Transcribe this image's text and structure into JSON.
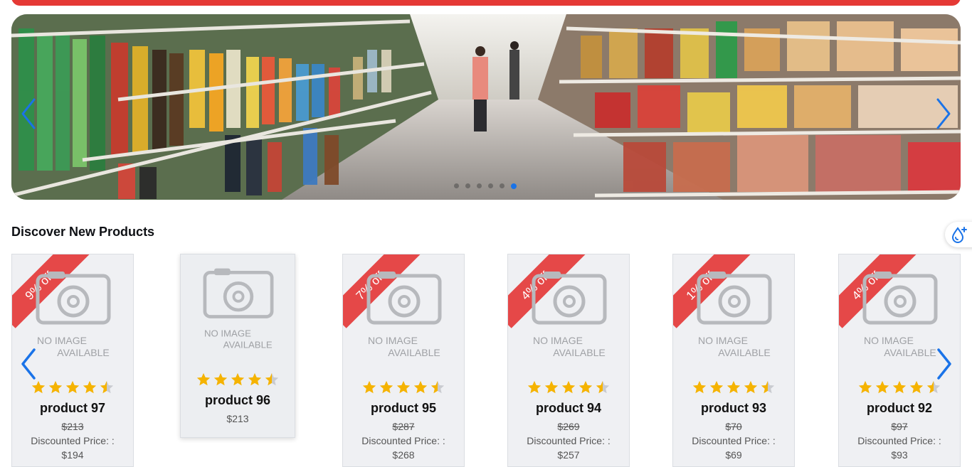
{
  "banner": {
    "slide_count": 6,
    "active_slide": 6
  },
  "section": {
    "title": "Discover New Products"
  },
  "products": [
    {
      "name": "product 97",
      "discount_badge": "9% off",
      "original_price": "$213",
      "discount_label": "Discounted Price: :",
      "discounted_price": "$194",
      "rating": 4.5
    },
    {
      "name": "product 96",
      "discount_badge": "",
      "price": "$213",
      "rating": 4.5
    },
    {
      "name": "product 95",
      "discount_badge": "7% off",
      "original_price": "$287",
      "discount_label": "Discounted Price: :",
      "discounted_price": "$268",
      "rating": 4.5
    },
    {
      "name": "product 94",
      "discount_badge": "4% off",
      "original_price": "$269",
      "discount_label": "Discounted Price: :",
      "discounted_price": "$257",
      "rating": 4.5
    },
    {
      "name": "product 93",
      "discount_badge": "1% off",
      "original_price": "$70",
      "discount_label": "Discounted Price: :",
      "discounted_price": "$69",
      "rating": 4.5
    },
    {
      "name": "product 92",
      "discount_badge": "4% off",
      "original_price": "$97",
      "discount_label": "Discounted Price: :",
      "discounted_price": "$93",
      "rating": 4.5
    }
  ],
  "placeholder_image": {
    "line1": "NO IMAGE",
    "line2": "AVAILABLE"
  },
  "colors": {
    "accent": "#1a73e8",
    "badge": "#e54848",
    "star": "#f5b301",
    "header": "#e53935"
  }
}
